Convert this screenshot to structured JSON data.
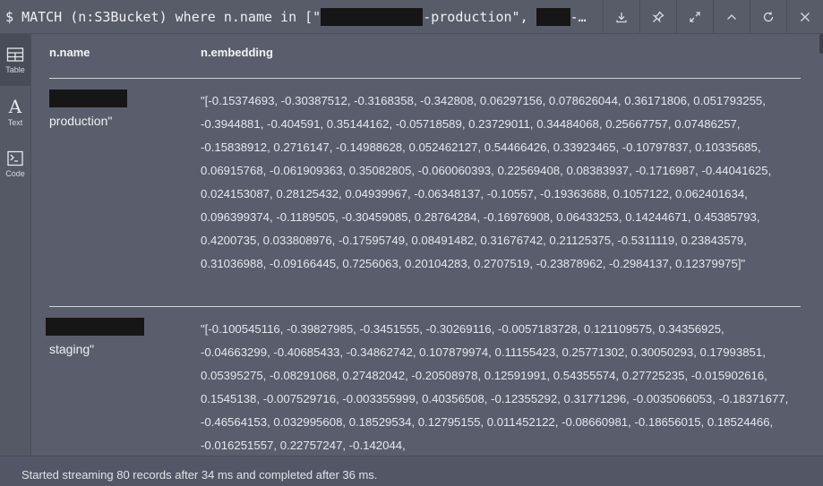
{
  "query": {
    "prompt": "$",
    "text_before": "MATCH (n:S3Bucket) where n.name in [\"",
    "text_middle": "-production\", ",
    "text_after": "-…"
  },
  "toolbar": {
    "icons": [
      "download-icon",
      "pin-icon",
      "expand-icon",
      "collapse-icon",
      "rerun-icon",
      "close-icon"
    ]
  },
  "views": [
    {
      "label": "Table",
      "icon": "table-icon",
      "active": true
    },
    {
      "label": "Text",
      "icon": "text-icon",
      "active": false
    },
    {
      "label": "Code",
      "icon": "code-icon",
      "active": false
    }
  ],
  "table": {
    "columns": [
      "n.name",
      "n.embedding"
    ],
    "rows": [
      {
        "name_suffix": "production\"",
        "embedding": "\"[-0.15374693, -0.30387512, -0.3168358, -0.342808, 0.06297156, 0.078626044, 0.36171806, 0.051793255, -0.3944881, -0.404591, 0.35144162, -0.05718589, 0.23729011, 0.34484068, 0.25667757, 0.07486257, -0.15838912, 0.2716147, -0.14988628, 0.052462127, 0.54466426, 0.33923465, -0.10797837, 0.10335685, 0.06915768, -0.061909363, 0.35082805, -0.060060393, 0.22569408, 0.08383937, -0.1716987, -0.44041625, 0.024153087, 0.28125432, 0.04939967, -0.06348137, -0.10557, -0.19363688, 0.1057122, 0.062401634, 0.096399374, -0.1189505, -0.30459085, 0.28764284, -0.16976908, 0.06433253, 0.14244671, 0.45385793, 0.4200735, 0.033808976, -0.17595749, 0.08491482, 0.31676742, 0.21125375, -0.5311119, 0.23843579, 0.31036988, -0.09166445, 0.7256063, 0.20104283, 0.2707519, -0.23878962, -0.2984137, 0.12379975]\""
      },
      {
        "name_suffix": "staging\"",
        "embedding": "\"[-0.100545116, -0.39827985, -0.3451555, -0.30269116, -0.0057183728, 0.121109575, 0.34356925, -0.04663299, -0.40685433, -0.34862742, 0.107879974, 0.11155423, 0.25771302, 0.30050293, 0.17993851, 0.05395275, -0.08291068, 0.27482042, -0.20508978, 0.12591991, 0.54355574, 0.27725235, -0.015902616, 0.1545138, -0.007529716, -0.003355999, 0.40356508, -0.12355292, 0.31771296, -0.0035066053, -0.18371677, -0.46564153, 0.032995608, 0.18529534, 0.12795155, 0.011452122, -0.08660981, -0.18656015, 0.18524466, -0.016251557, 0.22757247, -0.142044,"
      }
    ]
  },
  "footer": {
    "status": "Started streaming 80 records after 34 ms and completed after 36 ms."
  }
}
